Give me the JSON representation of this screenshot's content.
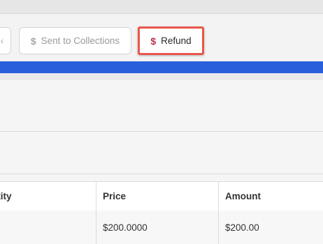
{
  "toolbar": {
    "partial_button_label": "‹",
    "collections_label": "Sent to Collections",
    "refund_label": "Refund",
    "dollar_icon": "$"
  },
  "colors": {
    "accent_blue": "#2a5fdc",
    "highlight_red": "#e9574a",
    "dollar_red": "#b8334a"
  },
  "table": {
    "headers": [
      "Quantity",
      "Price",
      "Amount"
    ],
    "header_visible": [
      "ntity",
      "Price",
      "Amount"
    ],
    "rows": [
      {
        "quantity": "",
        "price": "$200.0000",
        "amount": "$200.00"
      }
    ]
  }
}
